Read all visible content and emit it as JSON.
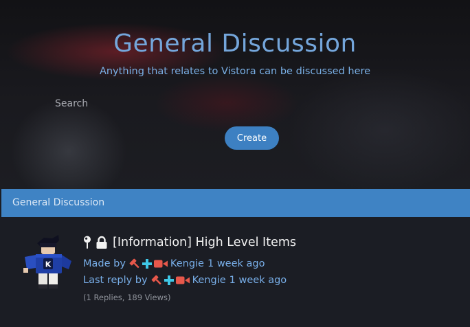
{
  "hero": {
    "title": "General Discussion",
    "subtitle": "Anything that relates to Vistora can be discussed here",
    "search_placeholder": "Search",
    "create_label": "Create"
  },
  "section": {
    "title": "General Discussion"
  },
  "thread": {
    "title": "[Information] High Level Items",
    "status_icons": [
      "pin-icon",
      "lock-icon"
    ],
    "made_by_label": "Made by",
    "author": "Kengie",
    "created": "1 week ago",
    "last_reply_label": "Last reply by",
    "last_reply_user": "Kengie",
    "last_reply_time": "1 week ago",
    "stats": "(1 Replies, 189 Views)",
    "user_badges": [
      "gavel-icon",
      "plus-icon",
      "video-camera-icon"
    ]
  },
  "colors": {
    "accent": "#3f83c4",
    "link": "#78aee8",
    "badge_red": "#e8584b",
    "badge_cyan": "#3fc7e6"
  }
}
